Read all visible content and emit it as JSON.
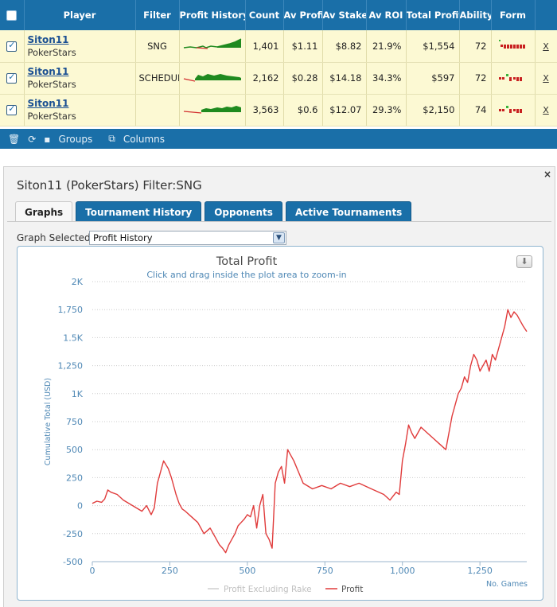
{
  "table": {
    "headers": [
      "Player",
      "Filter",
      "Profit History",
      "Count",
      "Av Profit",
      "Av Stake",
      "Av ROI",
      "Total Profit",
      "Ability",
      "Form"
    ],
    "rows": [
      {
        "name": "Siton11",
        "site": "PokerStars",
        "filter": "SNG",
        "count": "1,401",
        "av_profit": "$1.11",
        "av_stake": "$8.82",
        "av_roi": "21.9%",
        "total_profit": "$1,554",
        "ability": "72",
        "x": "X"
      },
      {
        "name": "Siton11",
        "site": "PokerStars",
        "filter": "SCHEDULED",
        "count": "2,162",
        "av_profit": "$0.28",
        "av_stake": "$14.18",
        "av_roi": "34.3%",
        "total_profit": "$597",
        "ability": "72",
        "x": "X"
      },
      {
        "name": "Siton11",
        "site": "PokerStars",
        "filter": "",
        "count": "3,563",
        "av_profit": "$0.6",
        "av_stake": "$12.07",
        "av_roi": "29.3%",
        "total_profit": "$2,150",
        "ability": "74",
        "x": "X"
      }
    ]
  },
  "toolbar": {
    "groups_label": "Groups",
    "columns_label": "Columns"
  },
  "panel": {
    "title": "Siton11 (PokerStars) Filter:SNG",
    "close": "×",
    "tabs": [
      "Graphs",
      "Tournament History",
      "Opponents",
      "Active Tournaments"
    ],
    "graph_selected_label": "Graph Selected:",
    "graph_selected_value": "Profit History"
  },
  "colors": {
    "header_blue": "#1a6fa8",
    "row_yellow": "#fcf9d3",
    "profit_red": "#e03b3b",
    "spark_green": "#1f8a1f",
    "axis_blue": "#4f88b5"
  },
  "chart_data": {
    "type": "line",
    "title": "Total Profit",
    "subtitle": "Click and drag inside the plot area to zoom-in",
    "ylabel": "Cumulative Total (USD)",
    "xlabel": "No. Games",
    "ylim": [
      -500,
      2000
    ],
    "xlim": [
      0,
      1401
    ],
    "yticks": [
      -500,
      -250,
      0,
      250,
      500,
      750,
      1000,
      1250,
      1500,
      1750,
      2000
    ],
    "ytick_labels": [
      "-500",
      "-250",
      "0",
      "250",
      "500",
      "750",
      "1K",
      "1,250",
      "1.5K",
      "1,750",
      "2K"
    ],
    "xticks": [
      0,
      250,
      500,
      750,
      1000,
      1250
    ],
    "xtick_labels": [
      "0",
      "250",
      "500",
      "750",
      "1,000",
      "1,250"
    ],
    "legend": [
      "Profit Excluding Rake",
      "Profit"
    ],
    "series": [
      {
        "name": "Profit",
        "x": [
          0,
          15,
          30,
          40,
          50,
          60,
          80,
          100,
          130,
          160,
          175,
          190,
          200,
          210,
          230,
          245,
          255,
          265,
          270,
          280,
          290,
          300,
          320,
          340,
          360,
          380,
          400,
          410,
          420,
          430,
          440,
          450,
          460,
          470,
          480,
          490,
          500,
          510,
          515,
          520,
          530,
          540,
          550,
          560,
          570,
          580,
          590,
          600,
          610,
          620,
          630,
          650,
          680,
          710,
          740,
          770,
          800,
          830,
          860,
          900,
          940,
          960,
          980,
          990,
          1000,
          1010,
          1020,
          1030,
          1040,
          1060,
          1080,
          1100,
          1120,
          1140,
          1160,
          1170,
          1180,
          1190,
          1200,
          1210,
          1220,
          1230,
          1240,
          1250,
          1260,
          1270,
          1280,
          1290,
          1300,
          1310,
          1320,
          1330,
          1340,
          1350,
          1360,
          1370,
          1380,
          1390,
          1401
        ],
        "y": [
          20,
          40,
          30,
          60,
          140,
          120,
          100,
          50,
          0,
          -50,
          0,
          -80,
          -20,
          200,
          400,
          330,
          250,
          150,
          100,
          20,
          -30,
          -50,
          -100,
          -150,
          -250,
          -200,
          -300,
          -350,
          -380,
          -420,
          -350,
          -300,
          -250,
          -180,
          -150,
          -120,
          -80,
          -100,
          -50,
          0,
          -200,
          0,
          100,
          -250,
          -300,
          -380,
          200,
          300,
          350,
          200,
          500,
          400,
          200,
          150,
          180,
          150,
          200,
          170,
          200,
          150,
          100,
          50,
          120,
          100,
          400,
          550,
          720,
          650,
          600,
          700,
          650,
          600,
          550,
          500,
          800,
          900,
          1000,
          1050,
          1150,
          1100,
          1250,
          1350,
          1300,
          1200,
          1250,
          1300,
          1200,
          1350,
          1300,
          1400,
          1500,
          1600,
          1750,
          1680,
          1730,
          1700,
          1650,
          1600,
          1554
        ]
      },
      {
        "name": "Profit Excluding Rake",
        "x": [],
        "y": []
      }
    ]
  }
}
